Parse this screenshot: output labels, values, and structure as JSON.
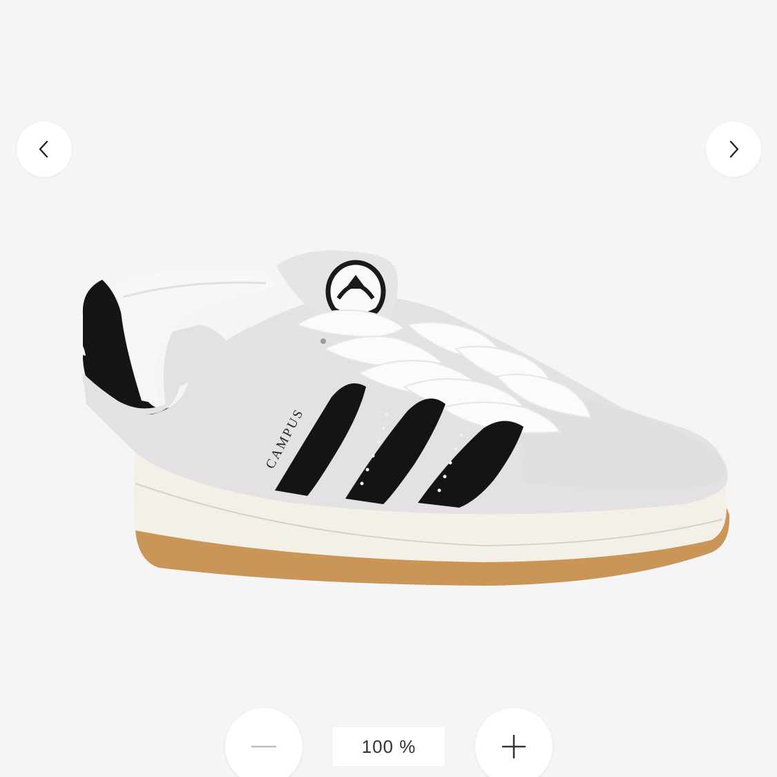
{
  "viewer": {
    "zoom_level": "100 %",
    "shoe_branding": "CAMPUS"
  },
  "icons": {
    "prev": "chevron-left-icon",
    "next": "chevron-right-icon",
    "zoom_out": "minus-icon",
    "zoom_in": "plus-icon"
  },
  "colors": {
    "background": "#f5f5f5",
    "suede": "#e4e1e4",
    "stripes": "#141414",
    "sole": "#f3f0e8",
    "gum": "#c99658"
  }
}
